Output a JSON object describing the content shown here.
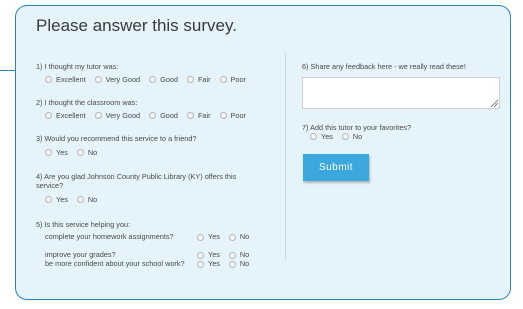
{
  "title": "Please answer this survey.",
  "q1": {
    "text": "1) I thought my tutor was:",
    "options": [
      "Excellent",
      "Very Good",
      "Good",
      "Fair",
      "Poor"
    ]
  },
  "q2": {
    "text": "2) I thought the classroom was:",
    "options": [
      "Excellent",
      "Very Good",
      "Good",
      "Fair",
      "Poor"
    ]
  },
  "q3": {
    "text": "3) Would you recommend this service to a friend?",
    "options": [
      "Yes",
      "No"
    ]
  },
  "q4": {
    "text": "4) Are you glad Johnson County Public Library (KY) offers this service?",
    "options": [
      "Yes",
      "No"
    ]
  },
  "q5": {
    "text": "5) Is this service helping you:",
    "items": [
      {
        "label": "complete your homework assignments?",
        "options": [
          "Yes",
          "No"
        ]
      },
      {
        "label": "improve your grades?",
        "options": [
          "Yes",
          "No"
        ]
      },
      {
        "label": "be more confident about your school work?",
        "options": [
          "Yes",
          "No"
        ]
      }
    ]
  },
  "q6": {
    "text": "6) Share any feedback here - we really read these!",
    "value": ""
  },
  "q7": {
    "text": "7) Add this tutor to your favorites?",
    "options": [
      "Yes",
      "No"
    ]
  },
  "submit_label": "Submit",
  "colors": {
    "card_bg": "#e5f3fa",
    "border": "#2e83b9",
    "button": "#3aa7dd"
  }
}
